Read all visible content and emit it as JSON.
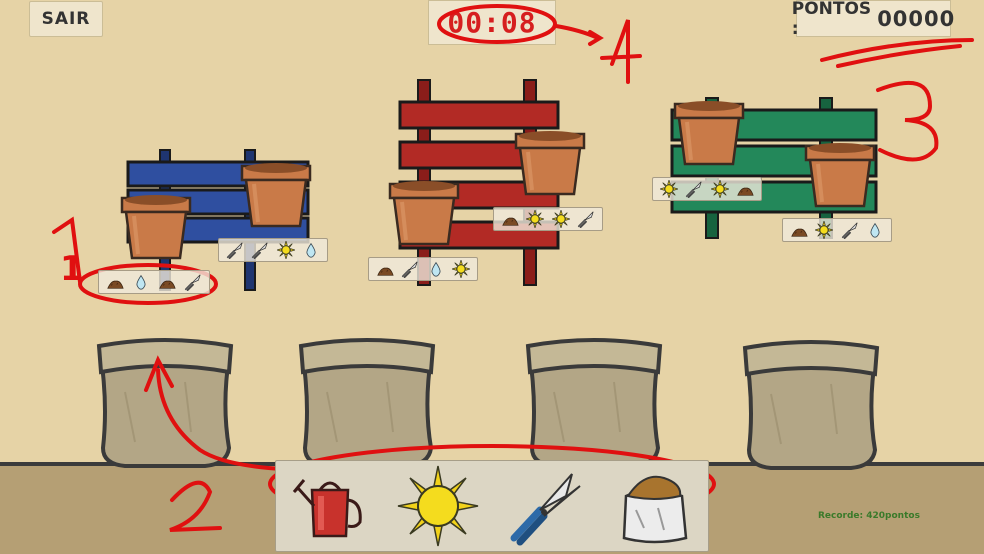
{
  "header": {
    "exit_label": "SAIR",
    "timer": "00:08",
    "score_label": "PONTOS :",
    "score_value": "00000"
  },
  "footer": {
    "record": "Recorde: 420pontos"
  },
  "colors": {
    "wall": "#e6d3a6",
    "floor": "#b59f74",
    "rack_blue": "#2f4fa0",
    "rack_red": "#b22a25",
    "rack_green": "#23885a",
    "pot": "#c97a48",
    "soil": "#8a4e28",
    "sack": "#b3a686",
    "annotation": "#e01010"
  },
  "annotations": [
    "1",
    "2",
    "3",
    "4"
  ],
  "plant_racks": [
    {
      "color": "blue",
      "pots": [
        {
          "needs": [
            "fertilizer-icon",
            "water-drop-icon",
            "fertilizer-icon",
            "shears-icon"
          ]
        },
        {
          "needs": [
            "shears-icon",
            "shears-icon",
            "sun-icon",
            "water-drop-icon"
          ]
        }
      ]
    },
    {
      "color": "red",
      "pots": [
        {
          "needs": [
            "fertilizer-icon",
            "shears-icon",
            "water-drop-icon",
            "sun-icon"
          ]
        },
        {
          "needs": [
            "fertilizer-icon",
            "sun-icon",
            "sun-icon",
            "shears-icon"
          ]
        }
      ]
    },
    {
      "color": "green",
      "pots": [
        {
          "needs": [
            "sun-icon",
            "shears-icon",
            "sun-icon",
            "fertilizer-icon"
          ]
        },
        {
          "needs": [
            "fertilizer-icon",
            "sun-icon",
            "shears-icon",
            "water-drop-icon"
          ]
        }
      ]
    }
  ],
  "tools": [
    "watering-can-icon",
    "sun-icon",
    "shears-icon",
    "fertilizer-sack-icon"
  ],
  "sacks_count": 4
}
